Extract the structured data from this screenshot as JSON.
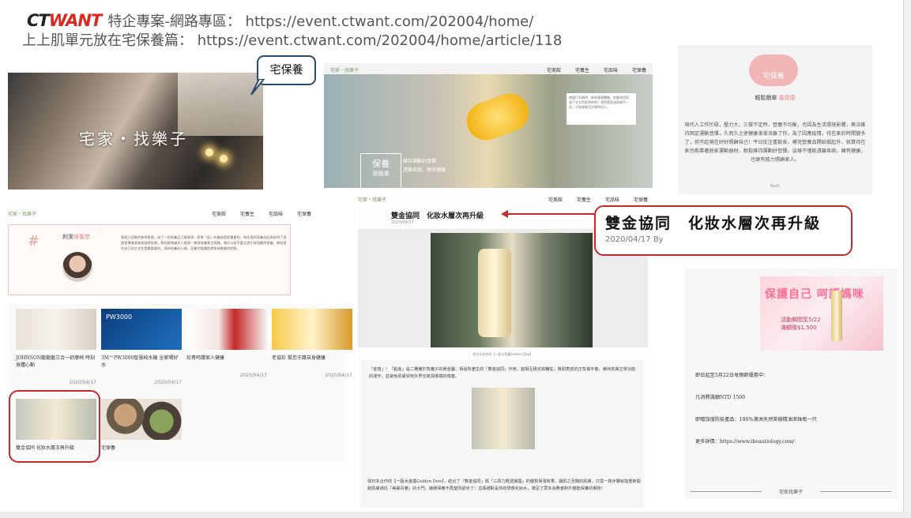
{
  "header": {
    "logo_part1": "CT",
    "logo_part2": "WANT",
    "line1": "特企專案-網路專區： https://event.ctwant.com/202004/home/",
    "line2": "上上肌單元放在宅保養篇： https://event.ctwant.com/202004/home/article/118"
  },
  "callout": {
    "label": "宅保養"
  },
  "hero1": {
    "title": "宅家・找樂子"
  },
  "site_nav": {
    "brand": "宅家・找樂子",
    "items": [
      "宅美館",
      "宅養生",
      "宅品味",
      "宅保養"
    ]
  },
  "hero2": {
    "card_text": "無論打利鍋時，擁有健康體魄，前聽來得家，留下甘甘的舒時時刻！我們還滋滋照開不一定，才能樂樂至於確時尚人。",
    "badge_main": "保養",
    "badge_sub": "很簡單",
    "tag1": "維持運動好習慣",
    "tag2": "遠離疾病，擁有健康"
  },
  "card_right": {
    "logo": "宅保養",
    "heading_a": "輕鬆簡單",
    "heading_b": "養健康",
    "body": "現代人工作忙碌，壓力大，三餐不定時，營養不均衡，也因為生活環境影響，無法維持固定運動習慣，久而久之使健康漸漸流離了你，為了因應疫情，待在家的時間變多了，何不趁現在好好照顧自己！平日從注重飲食，補充營養品開始做起外，就算待在家也能靠著居家運動器材，輕鬆維持運動好習慣，這樣不僅能遠離疾病，擁有健康，也更有能力照顧家人。",
    "back": "Back"
  },
  "blogger": {
    "name_a": "利潔",
    "name_b": "保養學",
    "text": "我個人認屬於敏性肌膚，試了一些保養品之後發現，原來「肌」的構成是很重要的，每次我的保養成因為有特了這個習慣後我漸漸發現肌膚，我也越來越多人跟我一樣對保養產生興趣。做好以前不要太過忙碌而顧到保養，尋找適合自己的方式才是最重要的，保持保養好心情，這樣才能讓肌膚保持最美的狀態。"
  },
  "products": [
    {
      "title": "JOHNSON龍龍龍三合一舒摩椅 時刻身體心動",
      "date": "2020/04/17"
    },
    {
      "title": "3M™PW3000智慧純水機 全家喝好水",
      "date": "2020/04/17",
      "img_label": "PW3000"
    },
    {
      "title": "珍貴呵護家人健康",
      "date": "2020/04/17"
    },
    {
      "title": "老協珍 幫您守護自身健康",
      "date": "2020/04/17"
    },
    {
      "title": "雙金協同 化妝水層次再升級",
      "date": ""
    },
    {
      "title": "宅保養",
      "date": ""
    }
  ],
  "article": {
    "title": "雙金協同　化妝水層次再升級",
    "date": "2020/04/17",
    "caption": "與日本合作的【一甌水金露Golden Dew】",
    "para1": "「金箔」！「鉑金」是二種備於負離子的貴金屬，相過所產生的「雙金協同」作用，能相互穩定與輔佐，幫助表皮的正負電平衡，維持皮膚正常功能的運作，並避免肌膚受到外界空氣與環境的傷害。",
    "para2": "與日本合作的【一甌水金露Golden Dew】，結合了「雙金協同」與「三原力輕透凝露」的優質保濕效果，讓肌之至關的肌膚，只需一抹步驟就能重新開啟肌膚通往「美麗青春」的大門，幾總保養不再望而卻步了！這瓶絕對是你的想像化妝水，滿足了眾多消費者對於機能保養的期待！"
  },
  "zoom": {
    "title": "雙金協同　化妝水層次再升級",
    "date": "2020/04/17 By"
  },
  "ad": {
    "banner_main": "保護自己 呵護媽咪",
    "banner_date": "活動期間至5/22",
    "banner_price": "滿額贈$1,500",
    "line1": "即日起至5月22日母親節優惠中：",
    "line2": "凡消費滿額NTD 1500",
    "line3": "即贈加值防疫產品：100%澳洲天然茶樹精油滾珠瓶一只",
    "line4": "更多詳情：https://www.ibeautiology.com/",
    "footer": "宅家找樂子"
  }
}
